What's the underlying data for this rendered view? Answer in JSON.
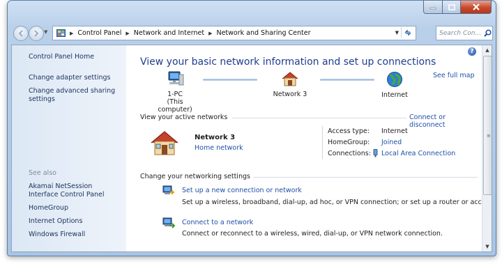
{
  "window": {
    "caption_buttons": {
      "minimize": "minimize",
      "maximize": "maximize",
      "close": "close"
    }
  },
  "navbar": {
    "breadcrumbs": [
      "Control Panel",
      "Network and Internet",
      "Network and Sharing Center"
    ],
    "search_placeholder": "Search Con..."
  },
  "sidebar": {
    "home": "Control Panel Home",
    "links": [
      "Change adapter settings",
      "Change advanced sharing settings"
    ],
    "see_also_label": "See also",
    "see_also": [
      "Akamai NetSession Interface Control Panel",
      "HomeGroup",
      "Internet Options",
      "Windows Firewall"
    ]
  },
  "main": {
    "title": "View your basic network information and set up connections",
    "see_full_map": "See full map",
    "map": {
      "pc_name": "1-PC",
      "pc_sub": "(This computer)",
      "network": "Network  3",
      "internet": "Internet"
    },
    "active_networks": {
      "header": "View your active networks",
      "action": "Connect or disconnect",
      "network_name": "Network  3",
      "network_type": "Home network",
      "access_type_label": "Access type:",
      "access_type_value": "Internet",
      "homegroup_label": "HomeGroup:",
      "homegroup_value": "Joined",
      "connections_label": "Connections:",
      "connections_value": "Local Area Connection"
    },
    "change_settings": {
      "header": "Change your networking settings",
      "tasks": [
        {
          "title": "Set up a new connection or network",
          "desc": "Set up a wireless, broadband, dial-up, ad hoc, or VPN connection; or set up a router or access point."
        },
        {
          "title": "Connect to a network",
          "desc": "Connect or reconnect to a wireless, wired, dial-up, or VPN network connection."
        }
      ]
    }
  },
  "colors": {
    "link": "#1f4fa8",
    "title": "#1e3d8f",
    "sidebar_link": "#1e3560"
  }
}
